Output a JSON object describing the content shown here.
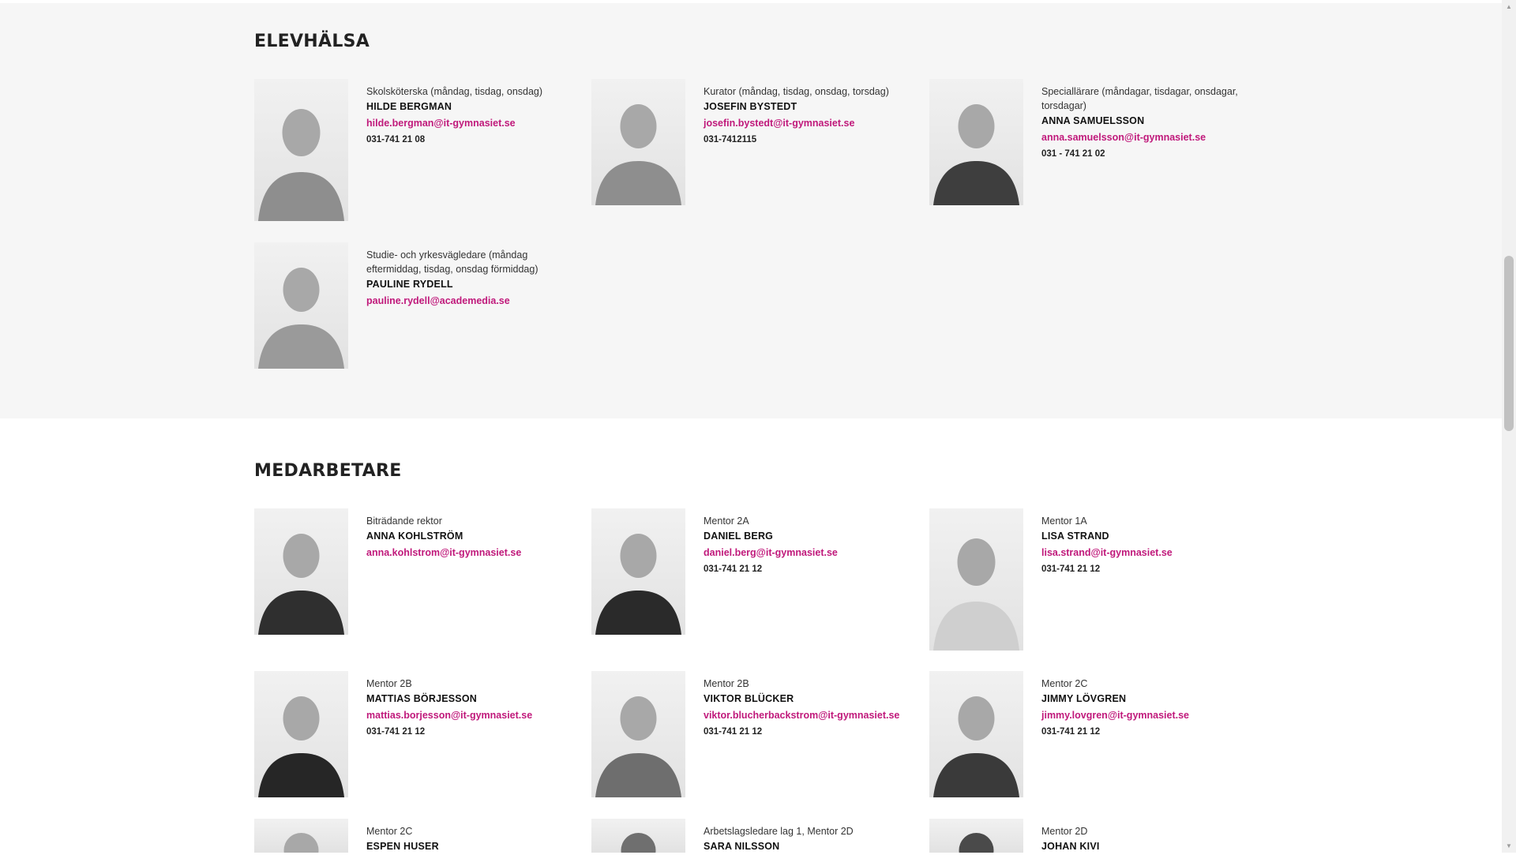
{
  "sections": {
    "elevhalsa": {
      "title": "ELEVHÄLSA",
      "people": [
        {
          "role": "Skolsköterska (måndag, tisdag, onsdag)",
          "name": "HILDE BERGMAN",
          "email": "hilde.bergman@it-gymnasiet.se",
          "phone": "031-741 21 08"
        },
        {
          "role": "Kurator (måndag, tisdag, onsdag, torsdag)",
          "name": "JOSEFIN BYSTEDT",
          "email": "josefin.bystedt@it-gymnasiet.se",
          "phone": "031-7412115"
        },
        {
          "role": "Speciallärare (måndagar, tisdagar, onsdagar, torsdagar)",
          "name": "ANNA SAMUELSSON",
          "email": "anna.samuelsson@it-gymnasiet.se",
          "phone": "031 - 741 21 02"
        },
        {
          "role": "Studie- och yrkesvägledare (måndag eftermiddag, tisdag, onsdag förmiddag)",
          "name": "PAULINE RYDELL",
          "email": "pauline.rydell@academedia.se",
          "phone": ""
        }
      ]
    },
    "medarbetare": {
      "title": "MEDARBETARE",
      "people": [
        {
          "role": "Biträdande rektor",
          "name": "ANNA KOHLSTRÖM",
          "email": "anna.kohlstrom@it-gymnasiet.se",
          "phone": ""
        },
        {
          "role": "Mentor 2A",
          "name": "DANIEL BERG",
          "email": "daniel.berg@it-gymnasiet.se",
          "phone": "031-741 21 12"
        },
        {
          "role": "Mentor 1A",
          "name": "LISA STRAND",
          "email": "lisa.strand@it-gymnasiet.se",
          "phone": "031-741 21 12"
        },
        {
          "role": "Mentor 2B",
          "name": "MATTIAS BÖRJESSON",
          "email": "mattias.borjesson@it-gymnasiet.se",
          "phone": "031-741 21 12"
        },
        {
          "role": "Mentor 2B",
          "name": "VIKTOR BLÜCKER",
          "email": "viktor.blucherbackstrom@it-gymnasiet.se",
          "phone": "031-741 21 12"
        },
        {
          "role": "Mentor 2C",
          "name": "JIMMY LÖVGREN",
          "email": "jimmy.lovgren@it-gymnasiet.se",
          "phone": "031-741 21 12"
        },
        {
          "role": "Mentor 2C",
          "name": "ESPEN HUSER",
          "email": "",
          "phone": ""
        },
        {
          "role": "Arbetslagsledare lag 1, Mentor 2D",
          "name": "SARA NILSSON",
          "email": "",
          "phone": ""
        },
        {
          "role": "Mentor 2D",
          "name": "JOHAN KIVI",
          "email": "",
          "phone": ""
        }
      ]
    }
  },
  "icons": {
    "portrait": "person-photo-icon",
    "scroll_up": "chevron-up-icon",
    "scroll_down": "chevron-down-icon"
  },
  "colors": {
    "accent": "#c0197b",
    "section_gray": "#f6f6f6",
    "text": "#222222"
  },
  "scroll_glyphs": {
    "up": "▲",
    "down": "▼"
  }
}
